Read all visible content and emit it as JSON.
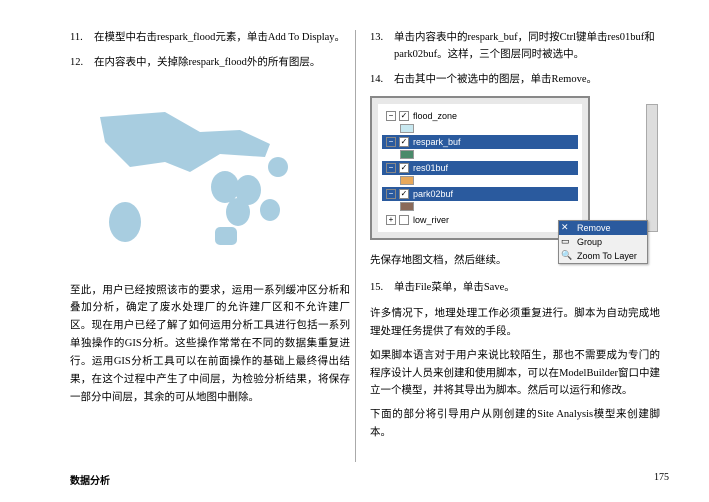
{
  "left": {
    "item11_num": "11.",
    "item11": "在模型中右击respark_flood元素，单击Add To Display。",
    "item12_num": "12.",
    "item12": "在内容表中，关掉除respark_flood外的所有图层。",
    "para": "至此，用户已经按照该市的要求，运用一系列缓冲区分析和叠加分析，确定了废水处理厂的允许建厂区和不允许建厂区。现在用户已经了解了如何运用分析工具进行包括一系列单独操作的GIS分析。这些操作常常在不同的数据集重复进行。运用GIS分析工具可以在前面操作的基础上最终得出结果，在这个过程中产生了中间层，为检验分析结果，将保存一部分中间层，其余的可从地图中删除。"
  },
  "right": {
    "item13_num": "13.",
    "item13": "单击内容表中的respark_buf，同时按Ctrl键单击res01buf和park02buf。这样，三个图层同时被选中。",
    "item14_num": "14.",
    "item14": "右击其中一个被选中的图层，单击Remove。",
    "panel": {
      "layers": {
        "flood_zone": "flood_zone",
        "respark_buf": "respark_buf",
        "res01buf": "res01buf",
        "park02buf": "park02buf",
        "low_river": "low_river"
      },
      "menu": {
        "remove": "Remove",
        "group": "Group",
        "zoom": "Zoom To Layer"
      }
    },
    "aftersave": "先保存地图文档，然后继续。",
    "item15_num": "15.",
    "item15": "单击File菜单，单击Save。",
    "para1": "许多情况下，地理处理工作必须重复进行。脚本为自动完成地理处理任务提供了有效的手段。",
    "para2": "如果脚本语言对于用户来说比较陌生，那也不需要成为专门的程序设计人员来创建和使用脚本，可以在ModelBuilder窗口中建立一个模型，并将其导出为脚本。然后可以运行和修改。",
    "para3": "下面的部分将引导用户从刚创建的Site Analysis模型来创建脚本。"
  },
  "footer": {
    "left": "数据分析",
    "right": "175"
  }
}
